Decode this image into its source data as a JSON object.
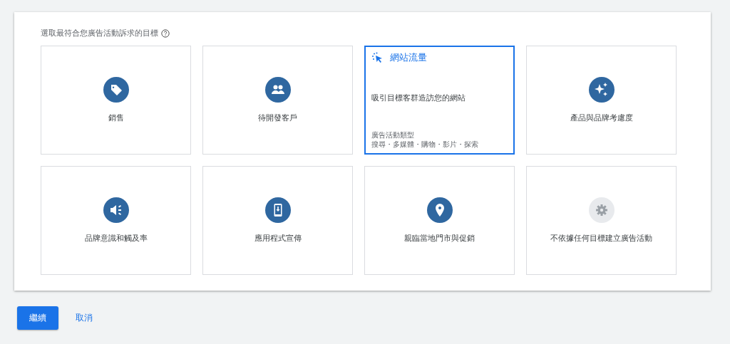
{
  "prompt": "選取最符合您廣告活動訴求的目標",
  "goals": [
    {
      "label": "銷售",
      "selected": false
    },
    {
      "label": "待開發客戶",
      "selected": false
    },
    {
      "label": "網站流量",
      "selected": true,
      "description": "吸引目標客群造訪您的網站",
      "types_label": "廣告活動類型",
      "types": "搜尋・多媒體・購物・影片・探索"
    },
    {
      "label": "產品與品牌考慮度",
      "selected": false
    },
    {
      "label": "品牌意識和觸及率",
      "selected": false
    },
    {
      "label": "應用程式宣傳",
      "selected": false
    },
    {
      "label": "親臨當地門市與促銷",
      "selected": false
    },
    {
      "label": "不依據任何目標建立廣告活動",
      "selected": false
    }
  ],
  "buttons": {
    "continue": "繼續",
    "cancel": "取消"
  }
}
